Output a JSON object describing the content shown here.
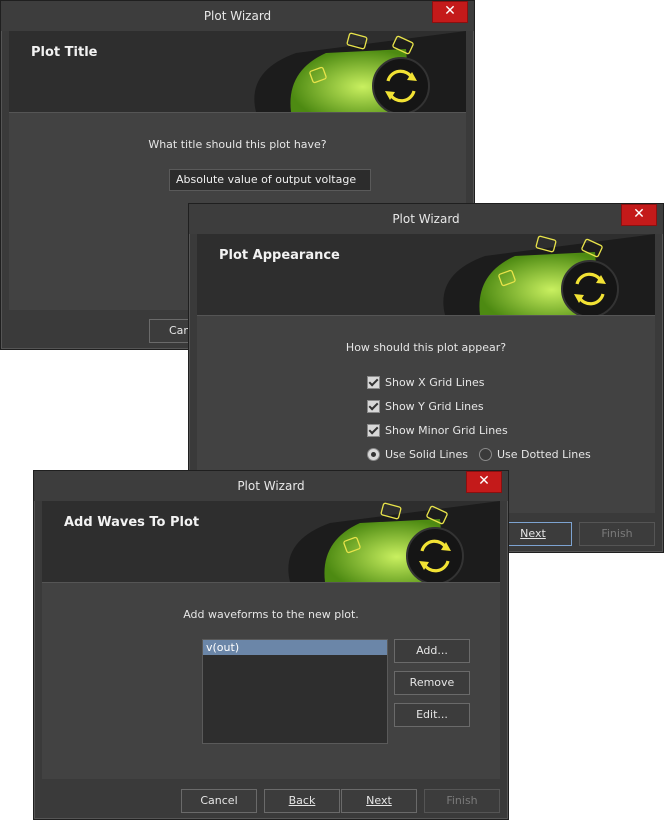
{
  "dialogs": {
    "title_dialog": {
      "window_title": "Plot Wizard",
      "close_label": "✕",
      "banner_title": "Plot Title",
      "prompt": "What title should this plot have?",
      "title_value": "Absolute value of output voltage",
      "cancel_partial": "Can"
    },
    "appearance_dialog": {
      "window_title": "Plot Wizard",
      "close_label": "✕",
      "banner_title": "Plot Appearance",
      "prompt": "How should this plot appear?",
      "options": {
        "show_x_grid": "Show X Grid Lines",
        "show_y_grid": "Show Y Grid Lines",
        "show_minor_grid": "Show Minor Grid Lines",
        "use_solid": "Use Solid Lines",
        "use_dotted": "Use Dotted Lines"
      },
      "next_label": "Next",
      "finish_label": "Finish"
    },
    "waves_dialog": {
      "window_title": "Plot Wizard",
      "close_label": "✕",
      "banner_title": "Add Waves To Plot",
      "prompt": "Add waveforms to the new plot.",
      "waves": [
        "v(out)"
      ],
      "add_label": "Add...",
      "remove_label": "Remove",
      "edit_label": "Edit...",
      "cancel_label": "Cancel",
      "back_label": "Back",
      "next_label": "Next",
      "finish_label": "Finish"
    }
  },
  "banner_icons": {
    "center": "refresh-icon",
    "keys": [
      "bridge-key-icon",
      "sim-key-icon",
      "sim-key-icon"
    ]
  },
  "colors": {
    "accent_green": "#8bd43a",
    "icon_yellow": "#f2e234",
    "close_red": "#c41a1a",
    "selection_blue": "#6b86a8"
  }
}
